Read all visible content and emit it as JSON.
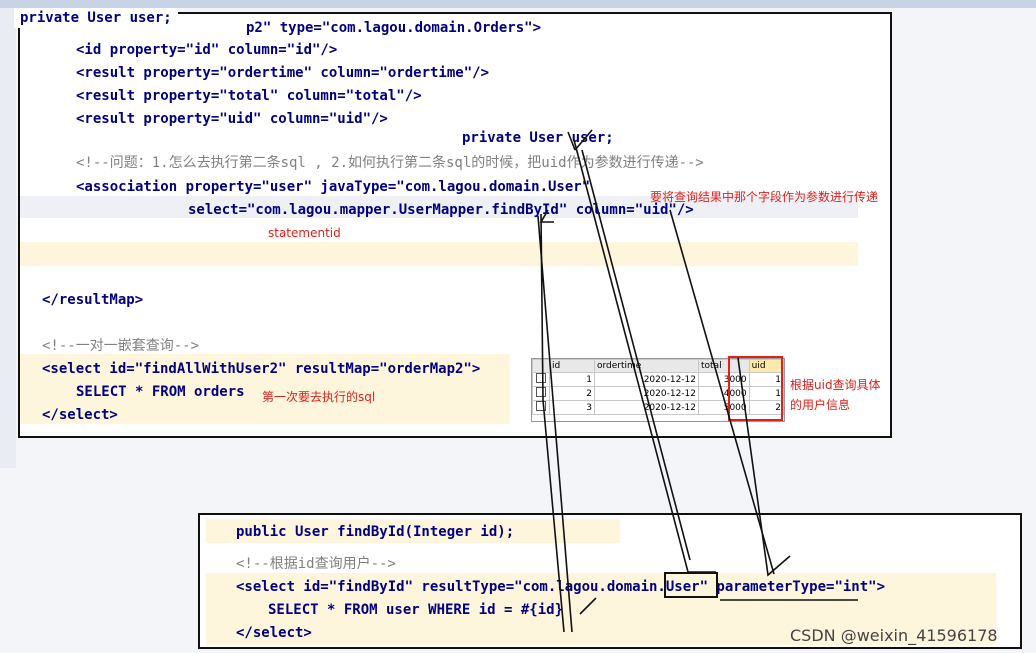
{
  "top_code": {
    "line_resultmap_tail": "p2\" type=\"com.lagou.domain.Orders\">",
    "line_id": "<id property=\"id\" column=\"id\"/>",
    "line_ordertime": "<result property=\"ordertime\" column=\"ordertime\"/>",
    "line_total": "<result property=\"total\" column=\"total\"/>",
    "line_uid": "<result property=\"uid\" column=\"uid\"/>",
    "comment_question": "<!--问题：1.怎么去执行第二条sql , 2.如何执行第二条sql的时候，把uid作为参数进行传递-->",
    "assoc_line1": "<association property=\"user\" javaType=\"com.lagou.domain.User\"",
    "assoc_line2": "select=\"com.lagou.mapper.UserMapper.findById\" column=\"uid\"/>",
    "end_resultmap": "</resultMap>",
    "comment_one_to_one": "<!--一对一嵌套查询-->",
    "select_open": "<select id=\"findAllWithUser2\" resultMap=\"orderMap2\">",
    "sql": "SELECT * FROM orders",
    "select_close": "</select>"
  },
  "snippet_private_user": "private User user;",
  "private_user_mid": "private User user;",
  "annotations": {
    "statementid": "statementid",
    "field_param": "要将查询结果中那个字段作为参数进行传递",
    "first_sql": "第一次要去执行的sql",
    "query_by_uid_1": "根据uid查询具体",
    "query_by_uid_2": "的用户信息"
  },
  "orders_table": {
    "headers": [
      "",
      "id",
      "ordertime",
      "total",
      "uid"
    ],
    "rows": [
      {
        "id": "1",
        "ordertime": "2020-12-12",
        "total": "3000",
        "uid": "1"
      },
      {
        "id": "2",
        "ordertime": "2020-12-12",
        "total": "4000",
        "uid": "1"
      },
      {
        "id": "3",
        "ordertime": "2020-12-12",
        "total": "5000",
        "uid": "2"
      }
    ]
  },
  "bottom_code": {
    "method_sig": "public User findById(Integer id);",
    "comment": "<!--根据id查询用户-->",
    "select_open": "<select id=\"findById\" resultType=\"com.lagou.domain.User\" parameterType=\"int\">",
    "sql": "SELECT * FROM user WHERE id = #{id}",
    "select_close": "</select>"
  },
  "watermark": "CSDN @weixin_41596178"
}
